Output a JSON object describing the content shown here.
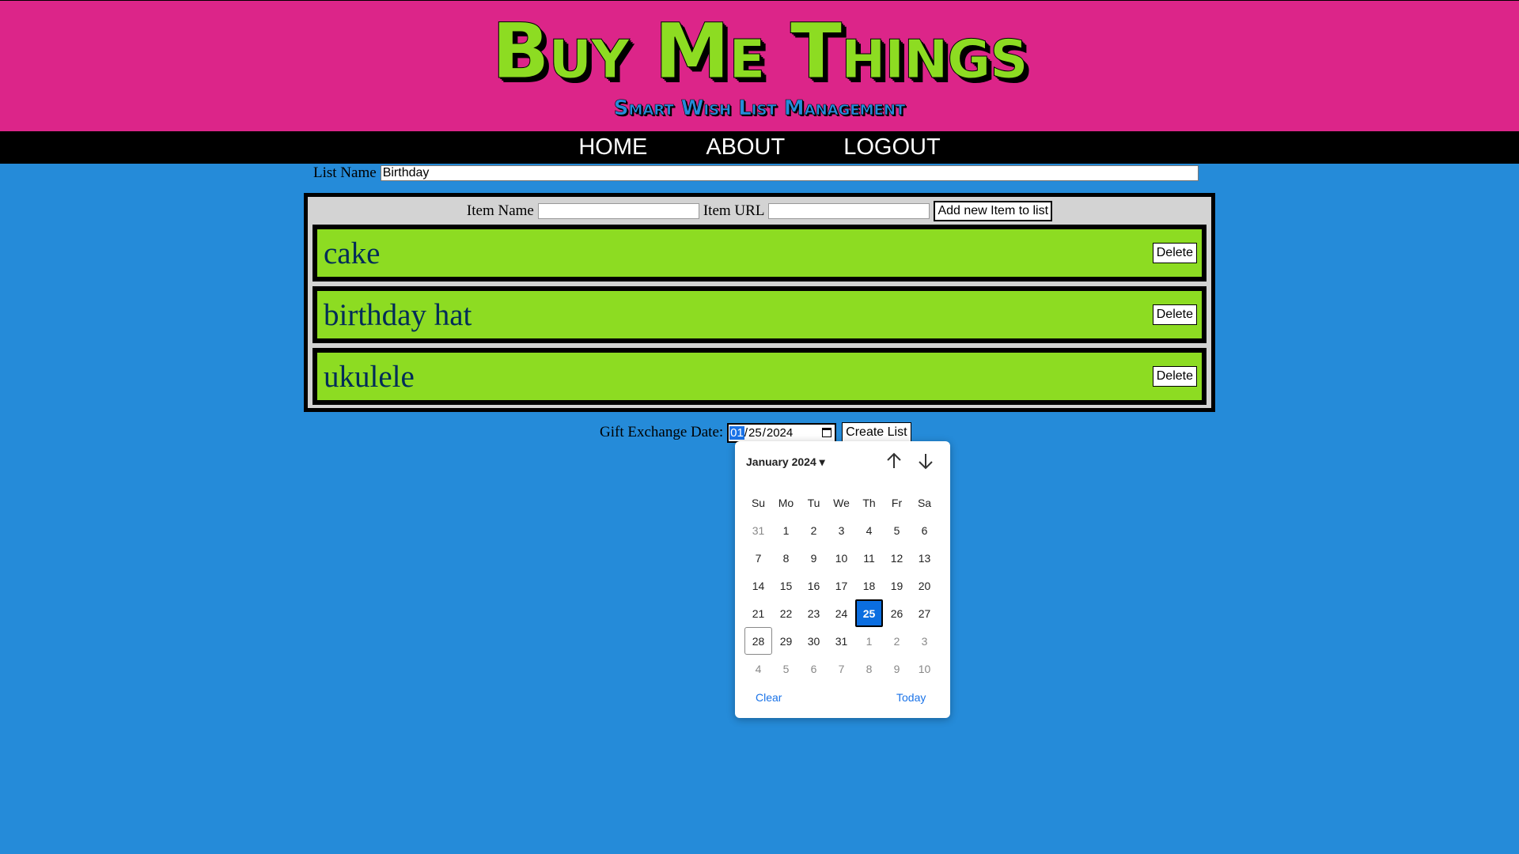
{
  "header": {
    "title": "Buy Me Things",
    "subtitle": "Smart Wish List Management"
  },
  "nav": {
    "items": [
      "HOME",
      "ABOUT",
      "LOGOUT"
    ]
  },
  "list_name": {
    "label": "List Name",
    "value": "Birthday"
  },
  "add_item": {
    "name_label": "Item Name",
    "name_value": "",
    "url_label": "Item URL",
    "url_value": "",
    "button": "Add new Item to list"
  },
  "items": [
    {
      "name": "cake",
      "delete": "Delete"
    },
    {
      "name": "birthday hat",
      "delete": "Delete"
    },
    {
      "name": "ukulele",
      "delete": "Delete"
    }
  ],
  "exchange": {
    "label": "Gift Exchange Date:",
    "month": "01",
    "day": "25",
    "year": "2024",
    "sep": "/",
    "create_button": "Create List"
  },
  "datepicker": {
    "month_label": "January 2024",
    "weekdays": [
      "Su",
      "Mo",
      "Tu",
      "We",
      "Th",
      "Fr",
      "Sa"
    ],
    "weeks": [
      [
        "31",
        "1",
        "2",
        "3",
        "4",
        "5",
        "6"
      ],
      [
        "7",
        "8",
        "9",
        "10",
        "11",
        "12",
        "13"
      ],
      [
        "14",
        "15",
        "16",
        "17",
        "18",
        "19",
        "20"
      ],
      [
        "21",
        "22",
        "23",
        "24",
        "25",
        "26",
        "27"
      ],
      [
        "28",
        "29",
        "30",
        "31",
        "1",
        "2",
        "3"
      ],
      [
        "4",
        "5",
        "6",
        "7",
        "8",
        "9",
        "10"
      ]
    ],
    "selected": "25",
    "today": "28",
    "clear": "Clear",
    "today_label": "Today"
  },
  "colors": {
    "background": "#258bd9",
    "header": "#dc2589",
    "accent_green": "#8ddc22",
    "selected_blue": "#0b6ee0"
  }
}
